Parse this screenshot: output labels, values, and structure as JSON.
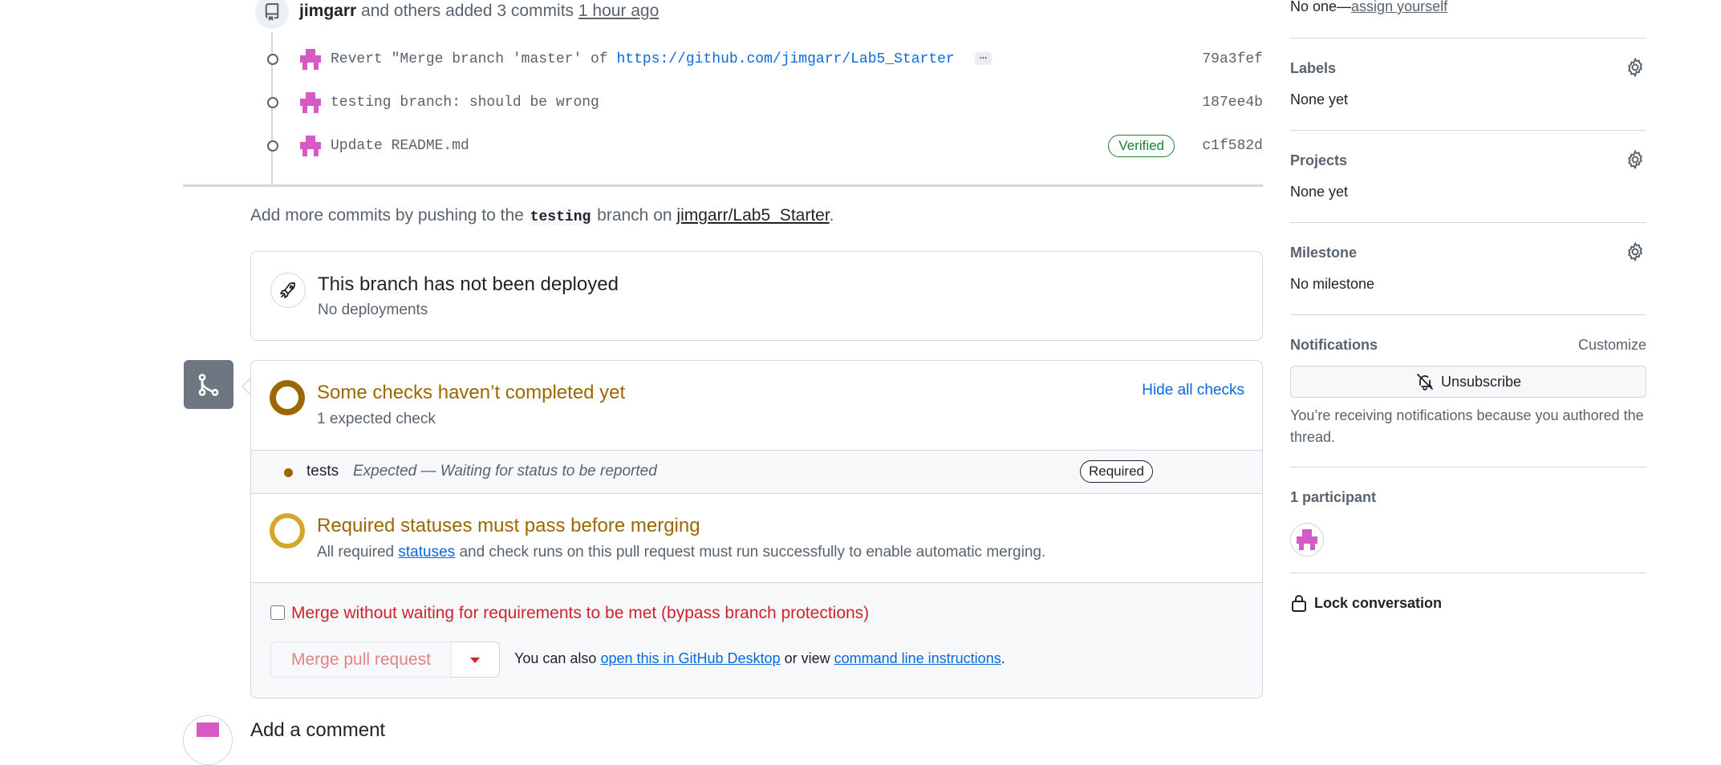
{
  "timeline": {
    "actor": "jimgarr",
    "action_text": "and others added 3 commits",
    "time_ago": "1 hour ago",
    "commits": [
      {
        "message": "Revert \"Merge branch 'master' of ",
        "link": "https://github.com/jimgarr/Lab5_Starter",
        "more": "…",
        "sha": "79a3fef"
      },
      {
        "message": "testing branch: should be wrong",
        "sha": "187ee4b"
      },
      {
        "message": "Update README.md",
        "badge": "Verified",
        "sha": "c1f582d"
      }
    ]
  },
  "push_hint": {
    "prefix": "Add more commits by pushing to the",
    "branch": "testing",
    "middle": "branch on",
    "repo": "jimgarr/Lab5_Starter",
    "suffix": "."
  },
  "deploy": {
    "title": "This branch has not been deployed",
    "subtitle": "No deployments"
  },
  "checks": {
    "title": "Some checks haven’t completed yet",
    "subtitle": "1 expected check",
    "hide_label": "Hide all checks",
    "items": [
      {
        "name": "tests",
        "description": "Expected — Waiting for status to be reported",
        "badge": "Required"
      }
    ]
  },
  "required": {
    "title": "Required statuses must pass before merging",
    "sub_prefix": "All required",
    "sub_link": "statuses",
    "sub_suffix": "and check runs on this pull request must run successfully to enable automatic merging."
  },
  "merge": {
    "bypass_label": "Merge without waiting for requirements to be met (bypass branch protections)",
    "bypass_checked": false,
    "button_label": "Merge pull request",
    "also_prefix": "You can also",
    "desktop_link": "open this in GitHub Desktop",
    "or_view": "or view",
    "cli_link": "command line instructions",
    "also_suffix": "."
  },
  "comment": {
    "heading": "Add a comment"
  },
  "sidebar": {
    "assignees_value": "No one—",
    "assign_link": "assign yourself",
    "labels": {
      "heading": "Labels",
      "value": "None yet"
    },
    "projects": {
      "heading": "Projects",
      "value": "None yet"
    },
    "milestone": {
      "heading": "Milestone",
      "value": "No milestone"
    },
    "notifications": {
      "heading": "Notifications",
      "customize": "Customize",
      "button": "Unsubscribe",
      "note": "You’re receiving notifications because you authored the thread."
    },
    "participants": {
      "heading": "1 participant"
    },
    "lock": "Lock conversation"
  },
  "colors": {
    "attention": "#9a6700",
    "pending_ring": "#d4a72c",
    "danger": "#cf222e",
    "link": "#0969da",
    "success": "#1a7f37",
    "avatar": "#d65ac5"
  }
}
